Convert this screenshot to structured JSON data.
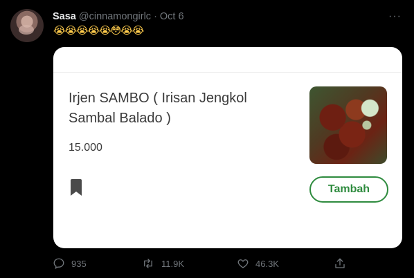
{
  "tweet": {
    "display_name": "Sasa",
    "handle": "@cinnamongirlc",
    "separator": "·",
    "timestamp": "Oct 6",
    "more_label": "···",
    "text": "😭😭😭😭😭😳😭😭"
  },
  "card": {
    "item_title": "Irjen SAMBO ( Irisan Jengkol Sambal Balado )",
    "price": "15.000",
    "add_button_label": "Tambah",
    "accent_color": "#2e8b3e"
  },
  "actions": {
    "replies": "935",
    "retweets": "11.9K",
    "likes": "46.3K"
  },
  "icons": {
    "more": "more-icon",
    "reply": "reply-icon",
    "retweet": "retweet-icon",
    "like": "heart-icon",
    "share": "share-icon",
    "bookmark": "bookmark-icon"
  },
  "colors": {
    "background": "#000000",
    "text_primary": "#e7e9ea",
    "text_secondary": "#71767b"
  }
}
